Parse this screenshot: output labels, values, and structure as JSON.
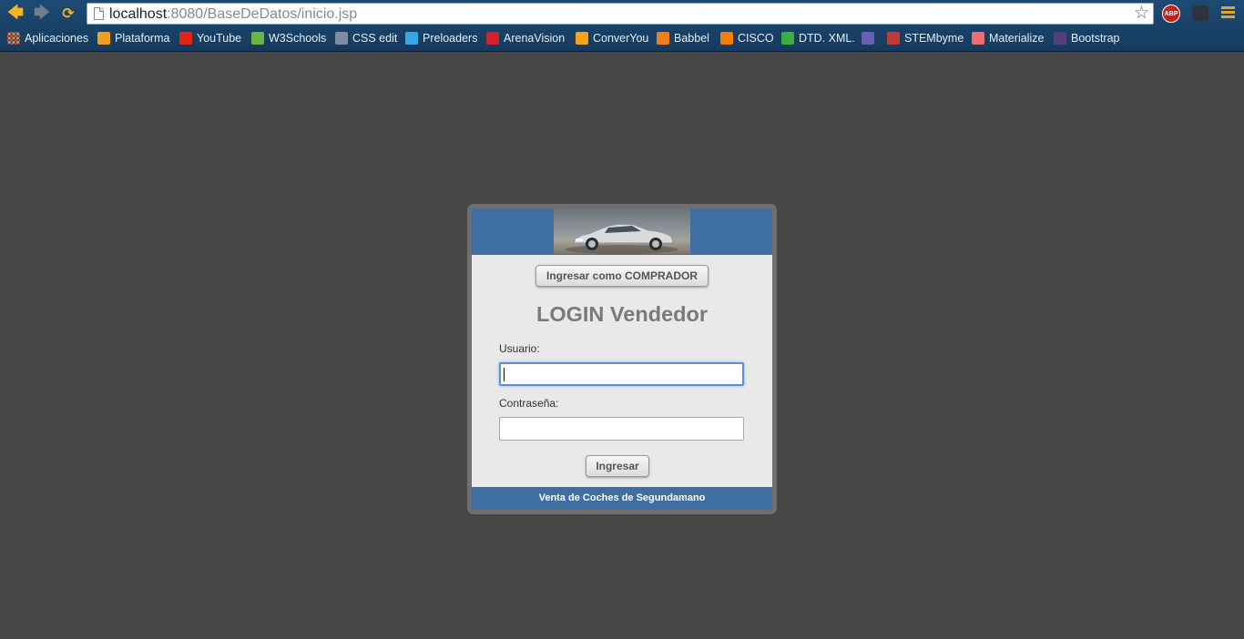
{
  "browser": {
    "url_host": "localhost",
    "url_rest": ":8080/BaseDeDatos/inicio.jsp",
    "abp_label": "ABP",
    "bookmarks": [
      {
        "label": "Aplicaciones",
        "icon": "apps-grid-icon",
        "color": "#e2a33a"
      },
      {
        "label": "Plataforma",
        "icon": "plataforma-icon",
        "color": "#f0a01c"
      },
      {
        "label": "YouTube",
        "icon": "youtube-icon",
        "color": "#e62117"
      },
      {
        "label": "W3Schools",
        "icon": "w3schools-icon",
        "color": "#6bb345"
      },
      {
        "label": "CSS edit",
        "icon": "folder-icon",
        "color": "#7e8da0"
      },
      {
        "label": "Preloaders",
        "icon": "preloaders-icon",
        "color": "#39a7e6"
      },
      {
        "label": "ArenaVision",
        "icon": "arenavision-icon",
        "color": "#d2232a"
      },
      {
        "label": "ConverYou",
        "icon": "converyou-icon",
        "color": "#f7a21b"
      },
      {
        "label": "Babbel",
        "icon": "babbel-icon",
        "color": "#f07e1b"
      },
      {
        "label": "CISCO",
        "icon": "blogger-icon",
        "color": "#f57d00"
      },
      {
        "label": "DTD. XML.",
        "icon": "check-icon",
        "color": "#3cae3f"
      },
      {
        "label": "",
        "icon": "image-bookmark-icon",
        "color": "#6a5fb0"
      },
      {
        "label": "STEMbyme",
        "icon": "stembyme-icon",
        "color": "#c23b3b"
      },
      {
        "label": "Materialize",
        "icon": "materialize-icon",
        "color": "#ee6e73"
      },
      {
        "label": "Bootstrap",
        "icon": "bootstrap-icon",
        "color": "#563d7c"
      }
    ]
  },
  "login": {
    "buyer_button": "Ingresar como COMPRADOR",
    "title": "LOGIN Vendedor",
    "user_label": "Usuario:",
    "user_value": "",
    "pass_label": "Contraseña:",
    "pass_value": "",
    "submit": "Ingresar",
    "footer": "Venta de Coches de Segundamano",
    "accent_color": "#3f6fa2"
  }
}
